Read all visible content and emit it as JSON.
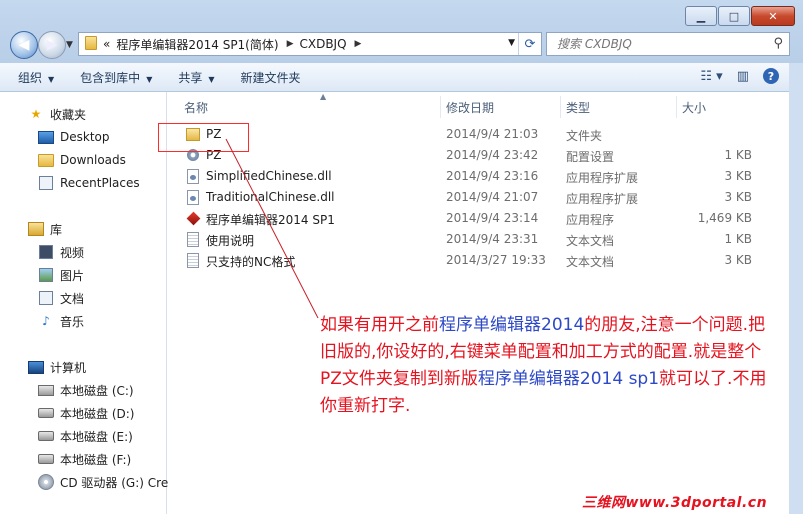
{
  "window": {
    "minimize": "▁",
    "maximize": "□",
    "close": "✕"
  },
  "address": {
    "root": "«",
    "segments": [
      "程序单编辑器2014 SP1(简体)",
      "CXDBJQ"
    ],
    "refresh_icon": "refresh-icon"
  },
  "search": {
    "placeholder": "搜索 CXDBJQ"
  },
  "toolbar": {
    "organize": "组织",
    "include_in_library": "包含到库中",
    "share": "共享",
    "new_folder": "新建文件夹"
  },
  "sidebar": {
    "favorites": "收藏夹",
    "favorites_items": [
      "Desktop",
      "Downloads",
      "RecentPlaces"
    ],
    "libraries": "库",
    "library_items": [
      "视频",
      "图片",
      "文档",
      "音乐"
    ],
    "computer": "计算机",
    "drives": [
      "本地磁盘 (C:)",
      "本地磁盘 (D:)",
      "本地磁盘 (E:)",
      "本地磁盘 (F:)",
      "CD 驱动器 (G:) Cre"
    ]
  },
  "columns": {
    "name": "名称",
    "date": "修改日期",
    "type": "类型",
    "size": "大小"
  },
  "files": [
    {
      "name": "PZ",
      "date": "2014/9/4 21:03",
      "type": "文件夹",
      "size": "",
      "icon": "folder-icon"
    },
    {
      "name": "PZ",
      "date": "2014/9/4 23:42",
      "type": "配置设置",
      "size": "1 KB",
      "icon": "config-file-icon"
    },
    {
      "name": "SimplifiedChinese.dll",
      "date": "2014/9/4 23:16",
      "type": "应用程序扩展",
      "size": "3 KB",
      "icon": "dll-file-icon"
    },
    {
      "name": "TraditionalChinese.dll",
      "date": "2014/9/4 21:07",
      "type": "应用程序扩展",
      "size": "3 KB",
      "icon": "dll-file-icon"
    },
    {
      "name": "程序单编辑器2014 SP1",
      "date": "2014/9/4 23:14",
      "type": "应用程序",
      "size": "1,469 KB",
      "icon": "app-exe-icon"
    },
    {
      "name": "使用说明",
      "date": "2014/9/4 23:31",
      "type": "文本文档",
      "size": "1 KB",
      "icon": "text-file-icon"
    },
    {
      "name": "只支持的NC格式",
      "date": "2014/3/27 19:33",
      "type": "文本文档",
      "size": "3 KB",
      "icon": "text-file-icon"
    }
  ],
  "annotation": {
    "p1": "如果有用开之前",
    "h1": "程序单编辑器2014",
    "p2": "的朋友,注意一个问题.把旧版的,你设好的,右键菜单配置和加工方式的配置.就是整个PZ文件夹复制到新版",
    "h2": "程序单编辑器2014 sp1",
    "p3": "就可以了.不用你重新打字."
  },
  "watermark": "三维网www.3dportal.cn",
  "colors": {
    "annotation_red": "#e5131f",
    "annotation_blue": "#2e49c7"
  }
}
